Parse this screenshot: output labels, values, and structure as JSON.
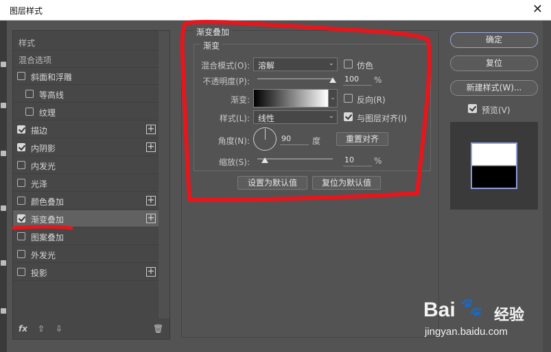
{
  "window": {
    "title": "图层样式",
    "close_glyph": "✕"
  },
  "style_list": {
    "header_styles": "样式",
    "header_blend": "混合选项",
    "items": [
      {
        "label": "斜面和浮雕",
        "checked": false,
        "plus": false,
        "indent": 0
      },
      {
        "label": "等高线",
        "checked": false,
        "plus": false,
        "indent": 1
      },
      {
        "label": "纹理",
        "checked": false,
        "plus": false,
        "indent": 1
      },
      {
        "label": "描边",
        "checked": true,
        "plus": true,
        "indent": 0
      },
      {
        "label": "内阴影",
        "checked": true,
        "plus": true,
        "indent": 0
      },
      {
        "label": "内发光",
        "checked": false,
        "plus": false,
        "indent": 0
      },
      {
        "label": "光泽",
        "checked": false,
        "plus": false,
        "indent": 0
      },
      {
        "label": "颜色叠加",
        "checked": false,
        "plus": true,
        "indent": 0
      },
      {
        "label": "渐变叠加",
        "checked": true,
        "plus": true,
        "indent": 0,
        "selected": true
      },
      {
        "label": "图案叠加",
        "checked": false,
        "plus": false,
        "indent": 0
      },
      {
        "label": "外发光",
        "checked": false,
        "plus": false,
        "indent": 0
      },
      {
        "label": "投影",
        "checked": false,
        "plus": true,
        "indent": 0
      }
    ],
    "toolbar": {
      "fx": "fx",
      "up": "⇧",
      "down": "⇩",
      "trash": "🗑"
    }
  },
  "gradient_overlay": {
    "section_title": "渐变叠加",
    "group_title": "渐变",
    "blend_mode_label": "混合模式(O):",
    "blend_mode_value": "溶解",
    "dither_label": "仿色",
    "dither_checked": false,
    "opacity_label": "不透明度(P):",
    "opacity_value": "100",
    "opacity_unit": "%",
    "opacity_fraction": 1.0,
    "gradient_label": "渐变:",
    "reverse_label": "反向(R)",
    "reverse_checked": false,
    "style_label": "样式(L):",
    "style_value": "线性",
    "align_label": "与图层对齐(I)",
    "align_checked": true,
    "angle_label": "角度(N):",
    "angle_value": "90",
    "angle_unit": "度",
    "reset_align_button": "重置对齐",
    "scale_label": "缩放(S):",
    "scale_value": "10",
    "scale_unit": "%",
    "scale_fraction": 0.1,
    "set_default_button": "设置为默认值",
    "reset_default_button": "复位为默认值"
  },
  "actions": {
    "ok": "确定",
    "reset": "复位",
    "new_style": "新建样式(W)...",
    "preview_label": "预览(V)",
    "preview_checked": true
  },
  "watermark": {
    "brand": "Bai",
    "brand_cn": "经验",
    "url": "jingyan.baidu.com"
  },
  "colors": {
    "annotation_red": "#e8151c",
    "dialog_bg": "#535353",
    "accent_border": "#9aa8d8"
  }
}
